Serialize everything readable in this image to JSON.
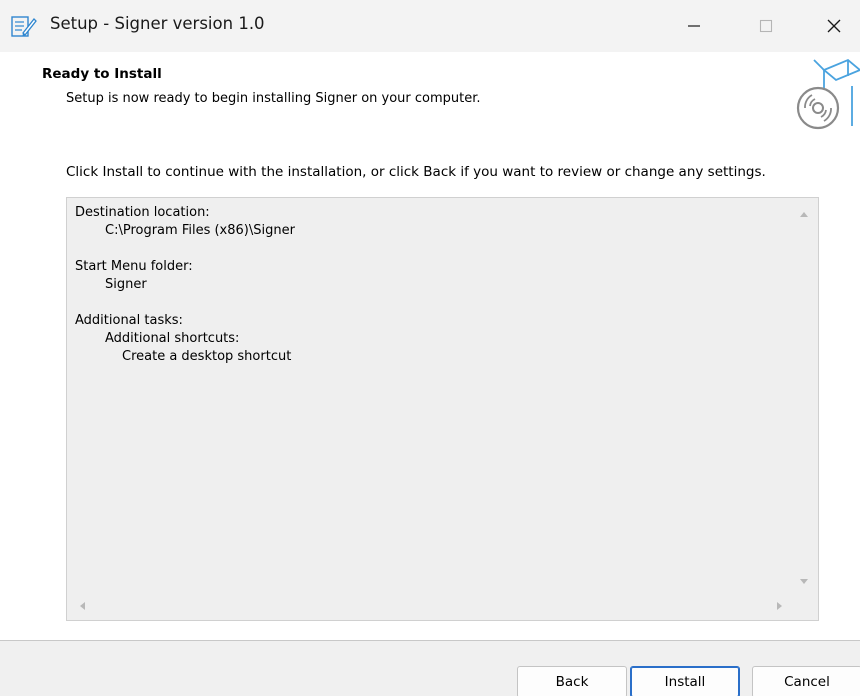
{
  "window": {
    "title": "Setup - Signer version 1.0",
    "icon": "setup-pencil-icon"
  },
  "header": {
    "title": "Ready to Install",
    "subtitle": "Setup is now ready to begin installing Signer on your computer.",
    "image": "box-disc-icon"
  },
  "intro": "Click Install to continue with the installation, or click Back if you want to review or change any settings.",
  "memo": {
    "dest_label": "Destination location:",
    "dest_value": "C:\\Program Files (x86)\\Signer",
    "startmenu_label": "Start Menu folder:",
    "startmenu_value": "Signer",
    "tasks_label": "Additional tasks:",
    "tasks_group": "Additional shortcuts:",
    "tasks_item": "Create a desktop shortcut"
  },
  "buttons": {
    "back": "Back",
    "install": "Install",
    "cancel": "Cancel"
  },
  "colors": {
    "accent": "#2a6fc9",
    "icon_blue": "#4aa3df"
  }
}
